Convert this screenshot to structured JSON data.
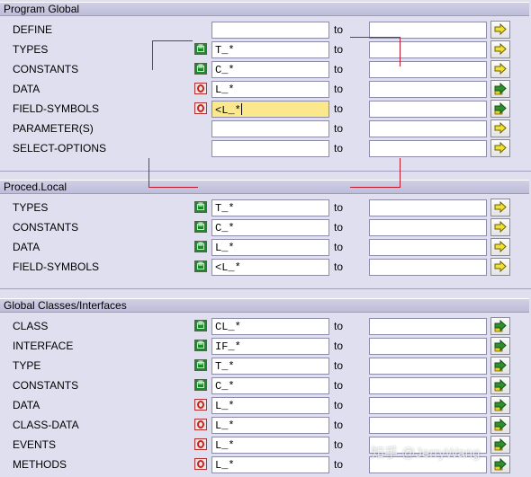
{
  "to_label": "to",
  "sections": [
    {
      "title": "Program Global",
      "rows": [
        {
          "label": "DEFINE",
          "option": null,
          "low": "",
          "high": "",
          "button": "plain"
        },
        {
          "label": "TYPES",
          "option": "include",
          "low": "T_*",
          "high": "",
          "button": "plain"
        },
        {
          "label": "CONSTANTS",
          "option": "include",
          "low": "C_*",
          "high": "",
          "button": "plain"
        },
        {
          "label": "DATA",
          "option": "exclude",
          "low": "L_*",
          "high": "",
          "button": "green"
        },
        {
          "label": "FIELD-SYMBOLS",
          "option": "exclude",
          "low": "<L_*",
          "high": "",
          "button": "green",
          "focused": true
        },
        {
          "label": "PARAMETER(S)",
          "option": null,
          "low": "",
          "high": "",
          "button": "plain"
        },
        {
          "label": "SELECT-OPTIONS",
          "option": null,
          "low": "",
          "high": "",
          "button": "plain"
        }
      ]
    },
    {
      "title": "Proced.Local",
      "rows": [
        {
          "label": "TYPES",
          "option": "include",
          "low": "T_*",
          "high": "",
          "button": "plain"
        },
        {
          "label": "CONSTANTS",
          "option": "include",
          "low": "C_*",
          "high": "",
          "button": "plain"
        },
        {
          "label": "DATA",
          "option": "include",
          "low": "L_*",
          "high": "",
          "button": "plain"
        },
        {
          "label": "FIELD-SYMBOLS",
          "option": "include",
          "low": "<L_*",
          "high": "",
          "button": "plain"
        }
      ]
    },
    {
      "title": "Global Classes/Interfaces",
      "rows": [
        {
          "label": "CLASS",
          "option": "include",
          "low": "CL_*",
          "high": "",
          "button": "green"
        },
        {
          "label": "INTERFACE",
          "option": "include",
          "low": "IF_*",
          "high": "",
          "button": "green"
        },
        {
          "label": "TYPE",
          "option": "include",
          "low": "T_*",
          "high": "",
          "button": "green"
        },
        {
          "label": "CONSTANTS",
          "option": "include",
          "low": "C_*",
          "high": "",
          "button": "green"
        },
        {
          "label": "DATA",
          "option": "exclude",
          "low": "L_*",
          "high": "",
          "button": "green"
        },
        {
          "label": "CLASS-DATA",
          "option": "exclude",
          "low": "L_*",
          "high": "",
          "button": "green"
        },
        {
          "label": "EVENTS",
          "option": "exclude",
          "low": "L_*",
          "high": "",
          "button": "green"
        },
        {
          "label": "METHODS",
          "option": "exclude",
          "low": "L_*",
          "high": "",
          "button": "green"
        }
      ]
    }
  ],
  "watermark": "知乎 @JerryWang",
  "colors": {
    "annotation": "#c0182c",
    "include": "#1f8a2c",
    "exclude": "#d02020",
    "focus_field": "#fbe88c"
  }
}
